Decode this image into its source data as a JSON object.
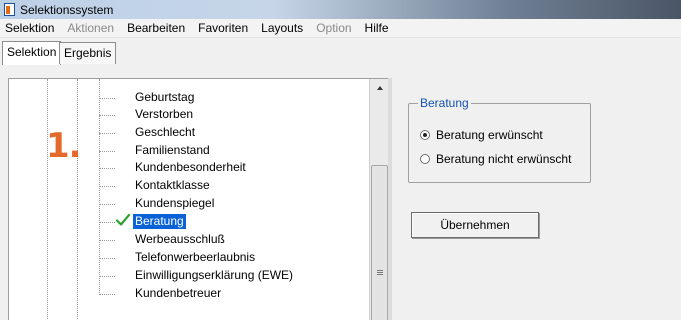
{
  "window": {
    "title": "Selektionssystem"
  },
  "menu": [
    "Selektion",
    "Aktionen",
    "Bearbeiten",
    "Favoriten",
    "Layouts",
    "Option",
    "Hilfe"
  ],
  "menu_disabled": [
    "Aktionen",
    "Option"
  ],
  "tabs": [
    "Selektion",
    "Ergebnis"
  ],
  "tree": {
    "items": [
      "Geburtstag",
      "Verstorben",
      "Geschlecht",
      "Familienstand",
      "Kundenbesonderheit",
      "Kontaktklasse",
      "Kundenspiegel",
      "Beratung",
      "Werbeausschluß",
      "Telefonwerbeerlaubnis",
      "Einwilligungserklärung (EWE)",
      "Kundenbetreuer"
    ],
    "selected": "Beratung",
    "checked": "Beratung",
    "check_icon": "green-checkmark-icon"
  },
  "annotation": {
    "step": "1."
  },
  "panel": {
    "group_title": "Beratung",
    "options": [
      "Beratung erwünscht",
      "Beratung nicht erwünscht"
    ],
    "selected_option": "Beratung erwünscht",
    "apply_button": "Übernehmen"
  },
  "colors": {
    "selection": "#0a62d6",
    "check": "#2ca02c",
    "annotation": "#e36a2b",
    "group_title": "#1453b3"
  }
}
